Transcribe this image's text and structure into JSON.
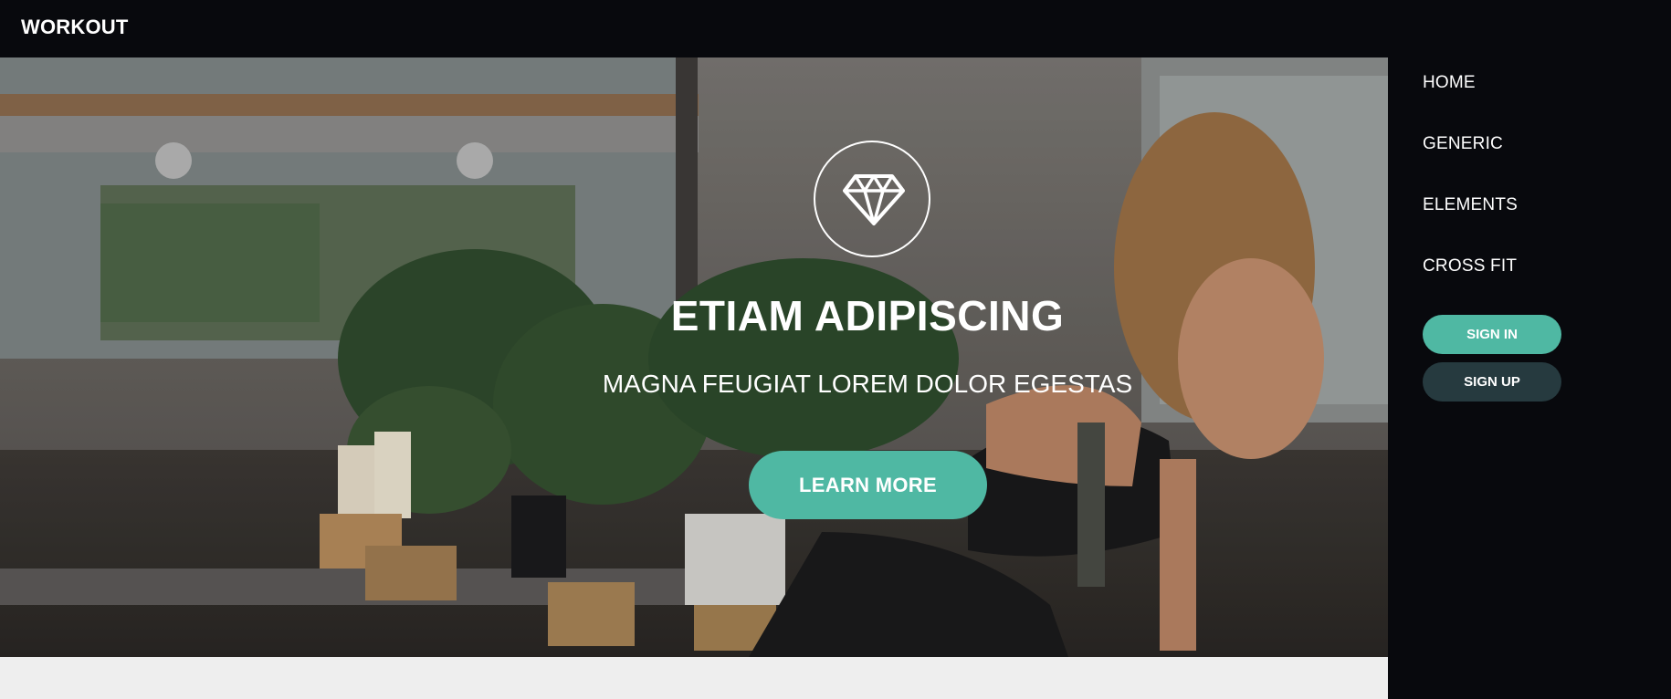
{
  "header": {
    "brand": "WORKOUT"
  },
  "hero": {
    "icon": "diamond-icon",
    "title": "ETIAM ADIPISCING",
    "subtitle": "MAGNA FEUGIAT LOREM DOLOR EGESTAS",
    "cta_label": "LEARN MORE"
  },
  "sidebar": {
    "nav": [
      "HOME",
      "GENERIC",
      "ELEMENTS",
      "CROSS FIT"
    ],
    "signin_label": "SIGN IN",
    "signup_label": "SIGN UP"
  },
  "colors": {
    "accent": "#4fb8a3",
    "dark_button": "#263a3f",
    "background_dark": "#08090d",
    "footer_light": "#eeeeee"
  }
}
